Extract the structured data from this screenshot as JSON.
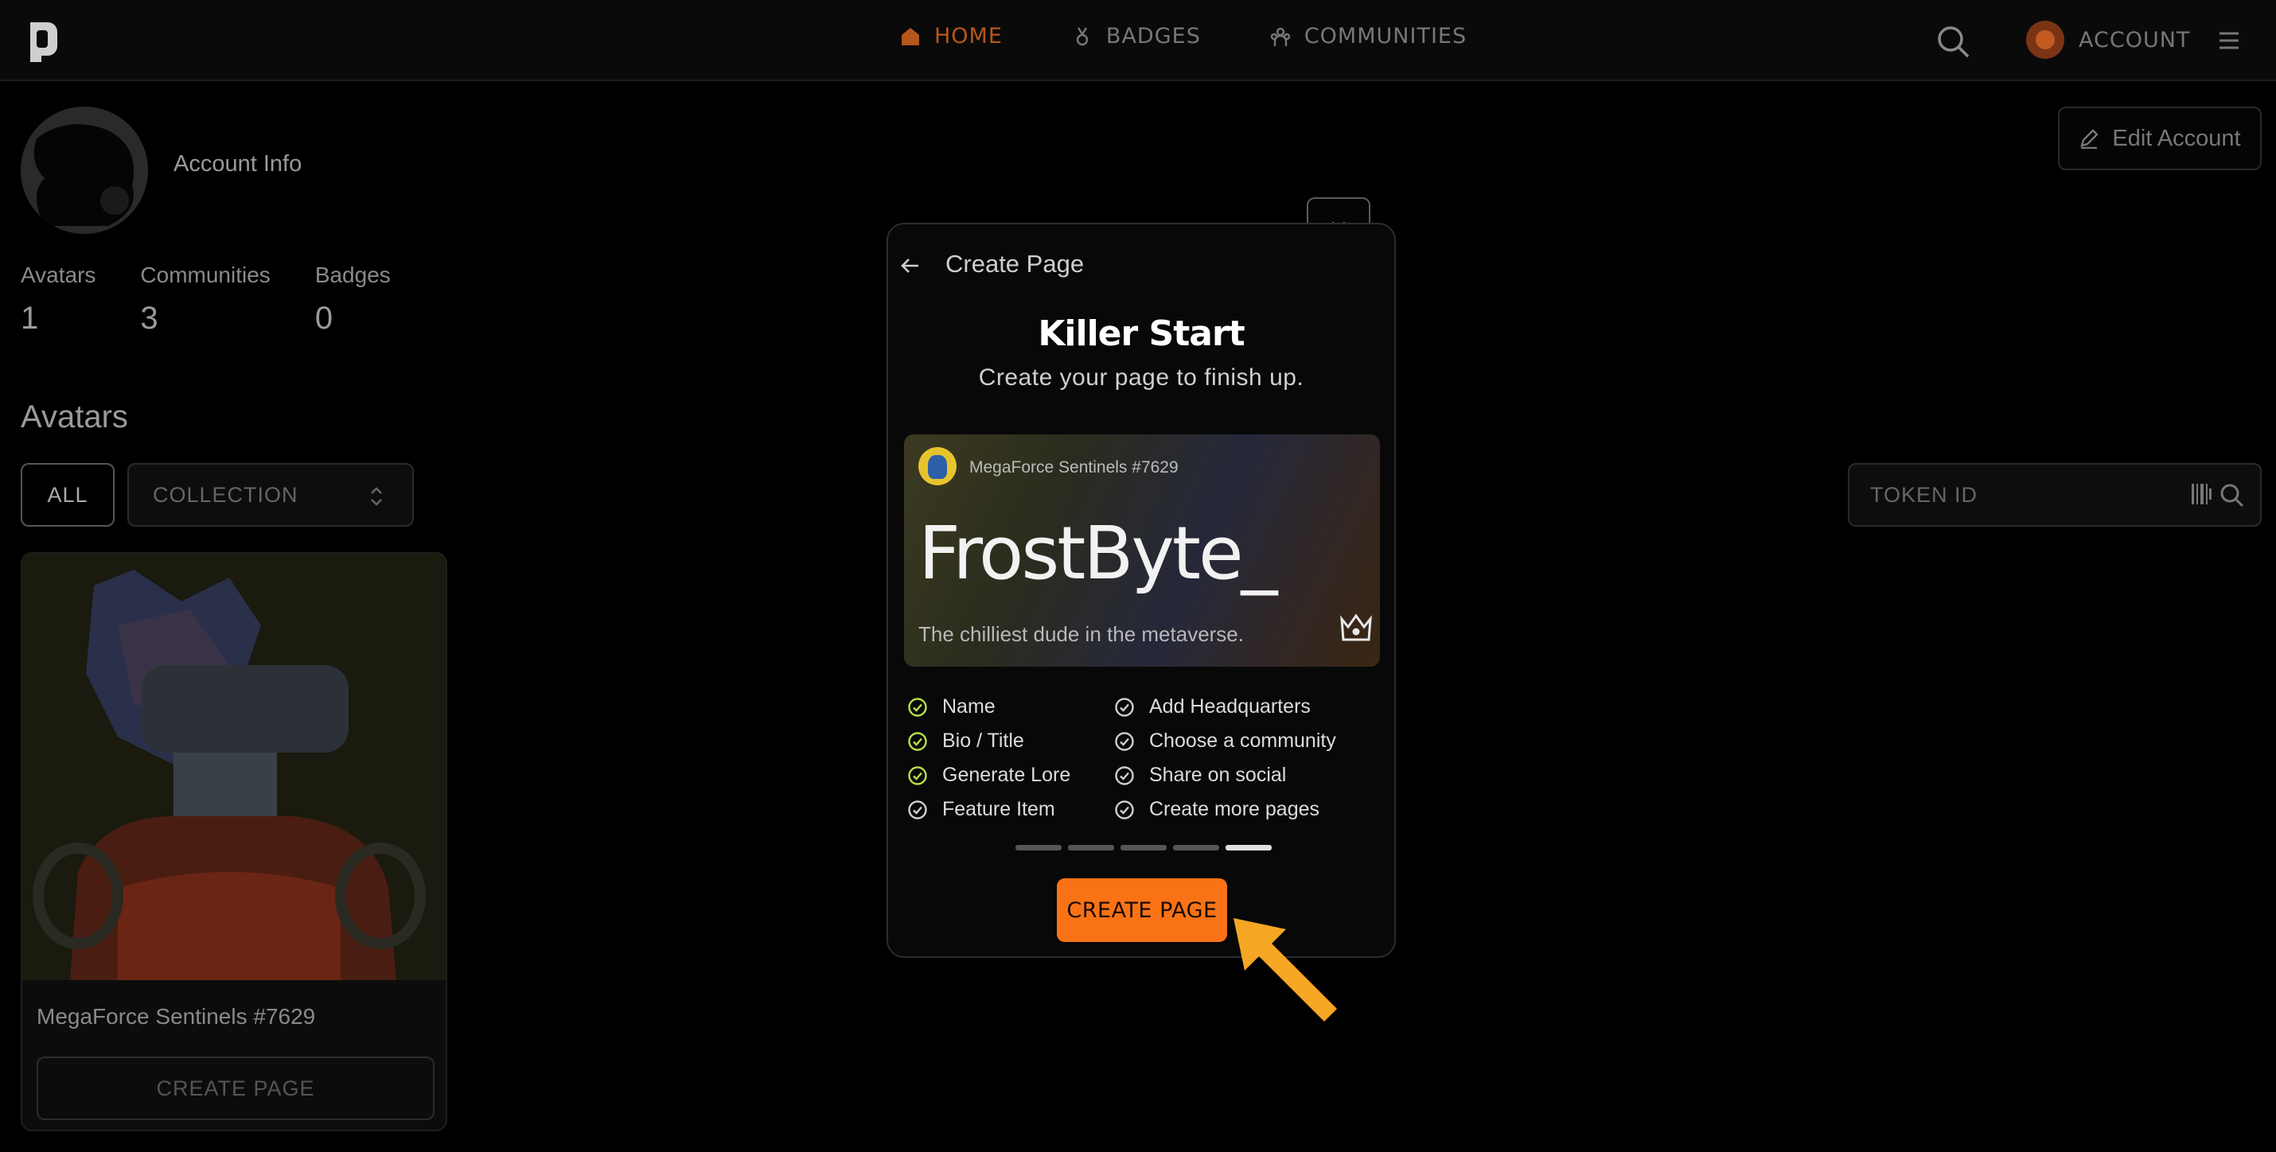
{
  "nav": {
    "home": "HOME",
    "badges": "BADGES",
    "communities": "COMMUNITIES",
    "account": "ACCOUNT"
  },
  "profile": {
    "title": "Account Info",
    "edit_button": "Edit Account",
    "stats": [
      {
        "label": "Avatars",
        "value": "1"
      },
      {
        "label": "Communities",
        "value": "3"
      },
      {
        "label": "Badges",
        "value": "0"
      }
    ]
  },
  "avatars_section": {
    "title": "Avatars",
    "filter_all": "ALL",
    "collection_select": "COLLECTION",
    "token_placeholder": "TOKEN ID",
    "cards": [
      {
        "name": "MegaForce Sentinels #7629",
        "button": "CREATE PAGE"
      }
    ]
  },
  "modal": {
    "title": "Create Page",
    "heading": "Killer Start",
    "subheading": "Create your page to finish up.",
    "preview": {
      "collection": "MegaForce Sentinels #7629",
      "name": "FrostByte_",
      "bio": "The chilliest dude in the metaverse."
    },
    "checklist": [
      {
        "label": "Name",
        "done": true
      },
      {
        "label": "Add Headquarters",
        "done": false
      },
      {
        "label": "Bio / Title",
        "done": true
      },
      {
        "label": "Choose a community",
        "done": false
      },
      {
        "label": "Generate Lore",
        "done": true
      },
      {
        "label": "Share on social",
        "done": false
      },
      {
        "label": "Feature Item",
        "done": false
      },
      {
        "label": "Create more pages",
        "done": false
      }
    ],
    "progress": {
      "steps": 5,
      "current": 5
    },
    "create_button": "CREATE PAGE"
  },
  "colors": {
    "accent": "#f97316",
    "check_done": "#b8e04a",
    "check_pending": "#cfcfcf",
    "arrow": "#f5a623"
  }
}
